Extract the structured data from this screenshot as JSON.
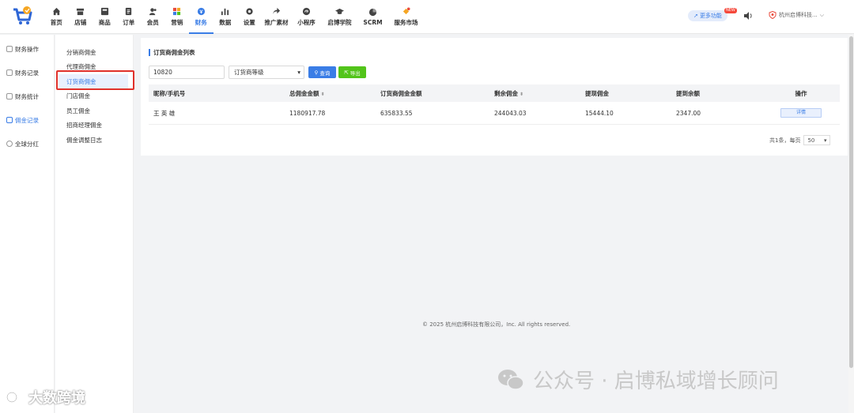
{
  "nav": {
    "items": [
      {
        "label": "首页",
        "icon": "home-icon"
      },
      {
        "label": "店铺",
        "icon": "store-icon"
      },
      {
        "label": "商品",
        "icon": "goods-icon"
      },
      {
        "label": "订单",
        "icon": "order-icon"
      },
      {
        "label": "会员",
        "icon": "member-icon"
      },
      {
        "label": "营销",
        "icon": "marketing-icon"
      },
      {
        "label": "财务",
        "icon": "finance-icon"
      },
      {
        "label": "数据",
        "icon": "data-icon"
      },
      {
        "label": "设置",
        "icon": "settings-icon"
      },
      {
        "label": "推广素材",
        "icon": "share-icon"
      },
      {
        "label": "小程序",
        "icon": "miniprogram-icon"
      },
      {
        "label": "启博学院",
        "icon": "academy-icon"
      },
      {
        "label": "SCRM",
        "icon": "scrm-icon"
      },
      {
        "label": "服务市场",
        "icon": "market-icon"
      }
    ],
    "active_index": 6,
    "more_label": "更多功能",
    "new_badge": "NEW",
    "company": "杭州启博科技..."
  },
  "sidebar1": {
    "items": [
      {
        "label": "财务操作"
      },
      {
        "label": "财务记录"
      },
      {
        "label": "财务统计"
      },
      {
        "label": "佣金记录"
      },
      {
        "label": "全球分红"
      }
    ],
    "active_index": 3
  },
  "sidebar2": {
    "items": [
      {
        "label": "分销商佣金"
      },
      {
        "label": "代理商佣金"
      },
      {
        "label": "订货商佣金"
      },
      {
        "label": "门店佣金"
      },
      {
        "label": "员工佣金"
      },
      {
        "label": "招商经理佣金"
      },
      {
        "label": "佣金调整日志"
      }
    ],
    "active_index": 2
  },
  "main": {
    "title": "订货商佣金列表",
    "search_value": "10820",
    "level_select": "订货商等级",
    "query_label": "查询",
    "export_label": "导出",
    "table": {
      "headers": [
        "昵称/手机号",
        "总佣金金额",
        "订货商佣金金额",
        "剩余佣金",
        "提现佣金",
        "提到余额",
        "操作"
      ],
      "rows": [
        [
          "王 英 雄",
          "1180917.78",
          "635833.55",
          "244043.03",
          "15444.10",
          "2347.00",
          "详情"
        ]
      ]
    },
    "pager": {
      "summary": "共1条，每页",
      "page_size": "50"
    }
  },
  "footer": {
    "copyright": "© 2025 杭州启博科技有限公司，Inc. All rights reserved."
  },
  "watermarks": {
    "left": "大数跨境",
    "right": "公众号 · 启博私域增长顾问"
  },
  "colors": {
    "accent": "#3a7de6",
    "export_green": "#52c41a",
    "highlight_red": "#e0312b"
  }
}
